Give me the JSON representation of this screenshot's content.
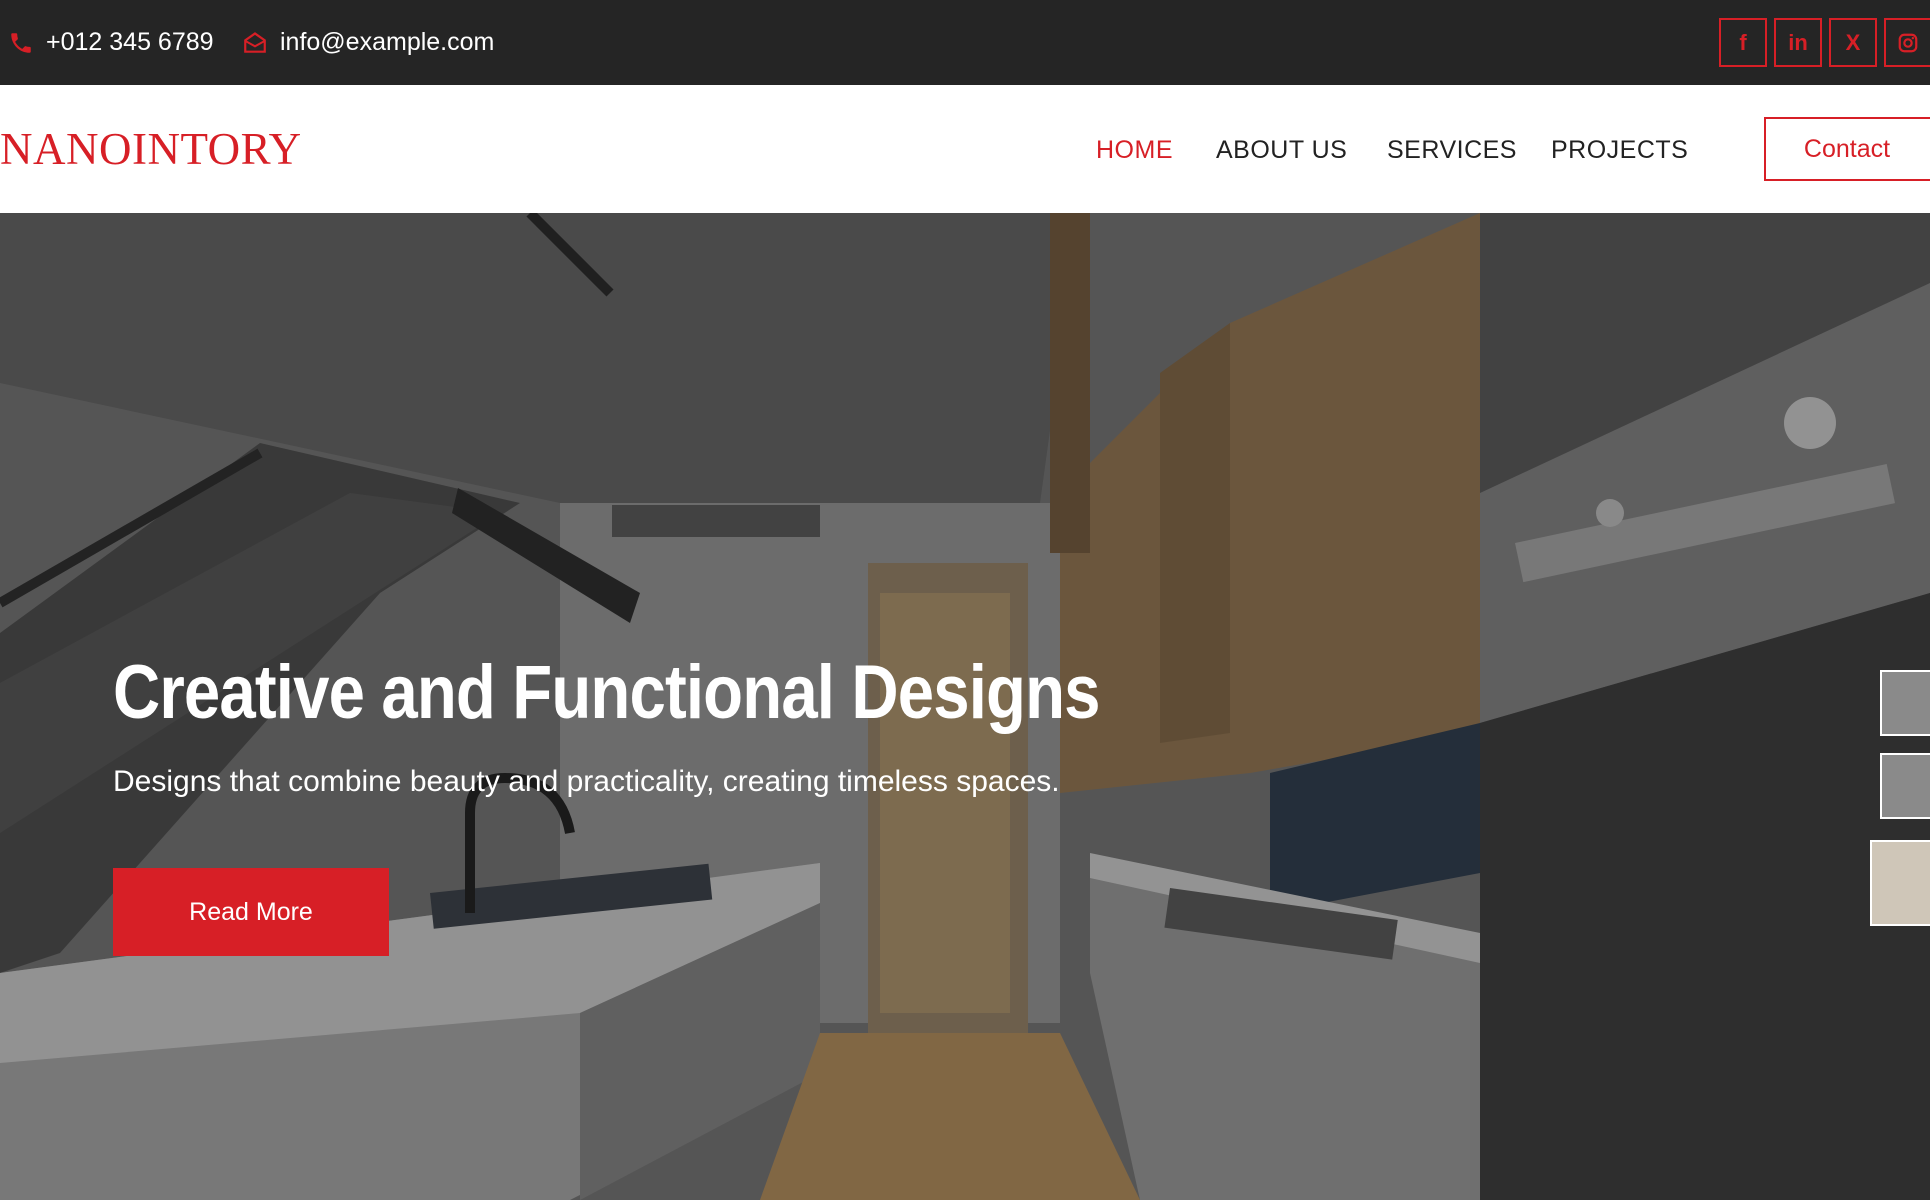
{
  "topbar": {
    "phone": "+012 345 6789",
    "email": "info@example.com",
    "socials": [
      {
        "icon": "facebook-icon",
        "glyph": "f"
      },
      {
        "icon": "linkedin-icon",
        "glyph": "in"
      },
      {
        "icon": "x-icon",
        "glyph": "X"
      },
      {
        "icon": "instagram-icon",
        "glyph": ""
      }
    ]
  },
  "navbar": {
    "logo": "NANOINTORY",
    "links": [
      "HOME",
      "ABOUT US",
      "SERVICES",
      "PROJECTS"
    ],
    "active": "HOME",
    "contact_label": "Contact"
  },
  "hero": {
    "title": "Creative and Functional Designs",
    "subtitle": "Designs that combine beauty and practicality, creating timeless spaces.",
    "cta_label": "Read More"
  },
  "colors": {
    "accent": "#d71f26",
    "topbar_bg": "#252525"
  }
}
